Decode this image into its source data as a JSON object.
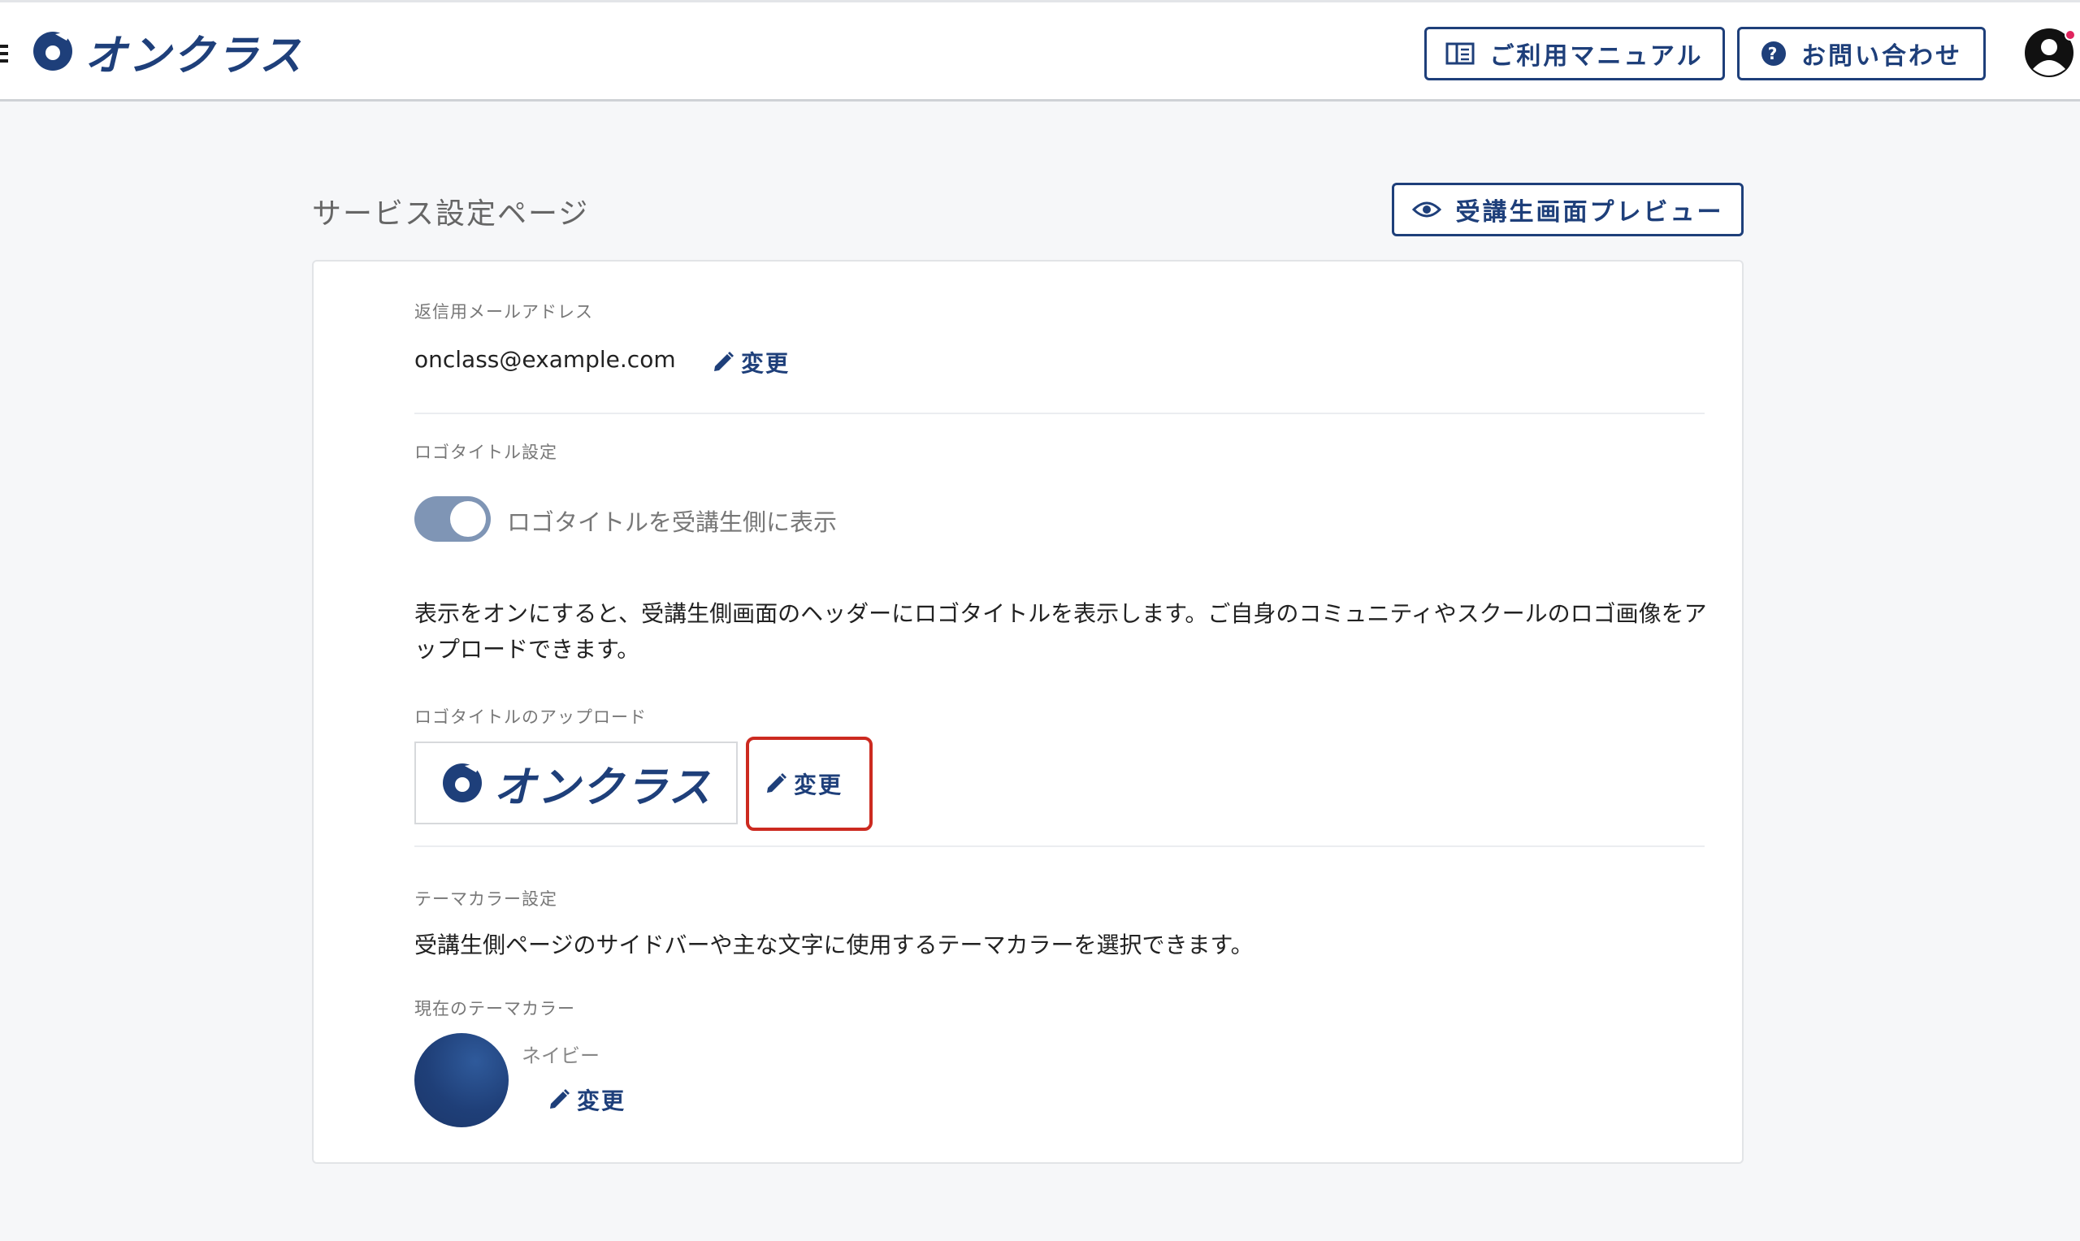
{
  "header": {
    "logo_text": "オンクラス",
    "manual_label": "ご利用マニュアル",
    "contact_label": "お問い合わせ"
  },
  "page": {
    "title": "サービス設定ページ",
    "preview_label": "受講生画面プレビュー"
  },
  "reply_email": {
    "label": "返信用メールアドレス",
    "value": "onclass@example.com",
    "change_label": "変更"
  },
  "logo_title": {
    "label": "ロゴタイトル設定",
    "toggle_label": "ロゴタイトルを受講生側に表示",
    "toggle_on": true,
    "description": "表示をオンにすると、受講生側画面のヘッダーにロゴタイトルを表示します。ご自身のコミュニティやスクールのロゴ画像をアップロードできます。",
    "upload_label": "ロゴタイトルのアップロード",
    "upload_logo_text": "オンクラス",
    "change_label": "変更"
  },
  "theme_color": {
    "label": "テーマカラー設定",
    "description": "受講生側ページのサイドバーや主な文字に使用するテーマカラーを選択できます。",
    "current_label": "現在のテーマカラー",
    "current_name": "ネイビー",
    "current_hex": "#1f3f78",
    "change_label": "変更"
  },
  "colors": {
    "brand": "#1e3f7a",
    "highlight": "#cc2a20",
    "notification": "#e0245e"
  }
}
